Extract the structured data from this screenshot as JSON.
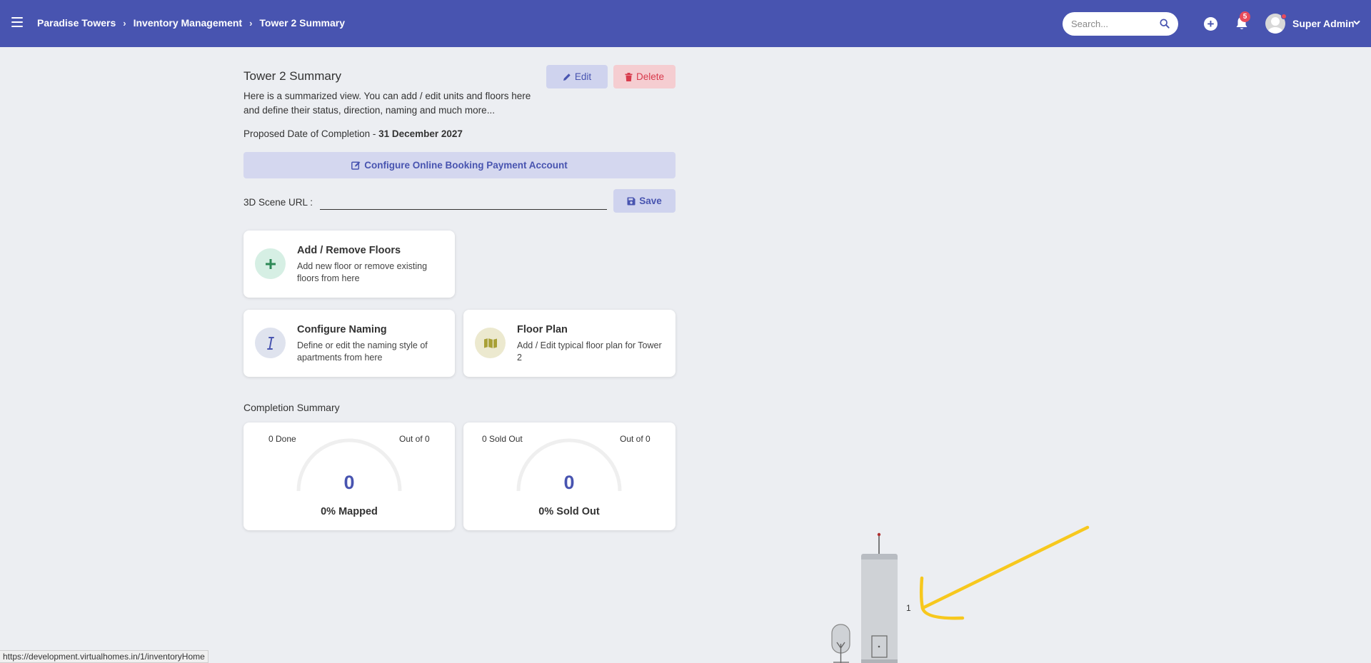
{
  "topbar": {
    "breadcrumb": [
      "Paradise Towers",
      "Inventory Management",
      "Tower 2 Summary"
    ],
    "search_placeholder": "Search...",
    "notification_count": "5",
    "user_name": "Super Admin",
    "plus_label": "+",
    "breadcrumb_sep": "›"
  },
  "page": {
    "title": "Tower 2 Summary",
    "description": "Here is a summarized view. You can add / edit units and floors here and define their status, direction, naming and much more...",
    "completion_prefix": "Proposed Date of Completion - ",
    "completion_date": "31 December 2027",
    "edit_label": "Edit",
    "delete_label": "Delete",
    "config_payment_label": "Configure Online Booking Payment Account",
    "url_label": "3D Scene URL :",
    "url_value": "",
    "save_label": "Save"
  },
  "cards": {
    "floors": {
      "title": "Add / Remove Floors",
      "desc": "Add new floor or remove existing floors from here",
      "icon": "plus-icon"
    },
    "naming": {
      "title": "Configure Naming",
      "desc": "Define or edit the naming style of apartments from here",
      "icon": "italic-i-icon"
    },
    "floorplan": {
      "title": "Floor Plan",
      "desc": "Add / Edit typical floor plan for Tower 2",
      "icon": "map-icon"
    }
  },
  "completion": {
    "title": "Completion Summary",
    "mapped": {
      "left": "0 Done",
      "right": "Out of 0",
      "value": "0",
      "caption": "0% Mapped",
      "fraction": 0
    },
    "sold": {
      "left": "0 Sold Out",
      "right": "Out of 0",
      "value": "0",
      "caption": "0% Sold Out",
      "fraction": 0
    }
  },
  "building": {
    "floor_label": "1"
  },
  "status_url": "https://development.virtualhomes.in/1/inventoryHome",
  "colors": {
    "topbar": "#4854b0",
    "accent": "#4854b0",
    "danger": "#d83a4c",
    "annotation": "#f7c81e"
  }
}
